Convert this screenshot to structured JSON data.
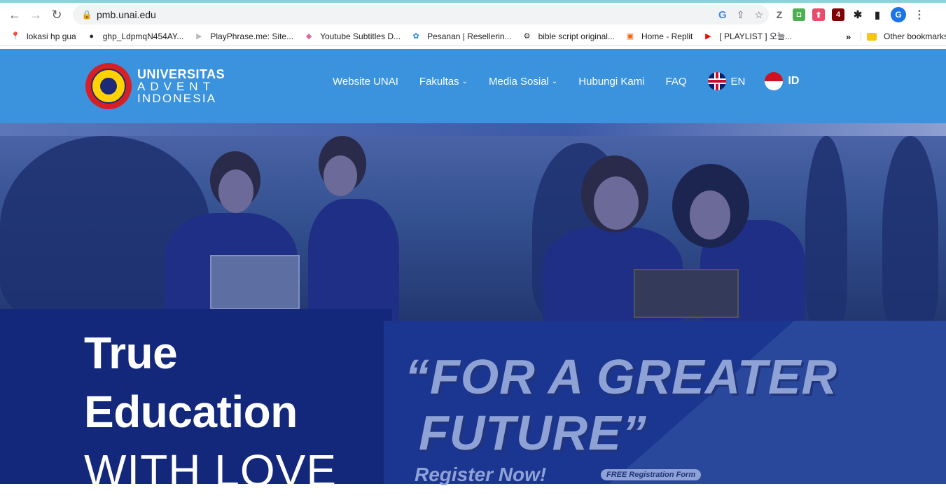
{
  "browser": {
    "url": "pmb.unai.edu",
    "back_icon": "←",
    "forward_icon": "→",
    "reload_icon": "↻",
    "lock_icon": "🔒",
    "google_icon": "G",
    "share_icon": "⇪",
    "star_icon": "☆",
    "menu_icon": "⋮",
    "avatar_letter": "G",
    "extensions": [
      {
        "name": "z-extension",
        "glyph": "Z",
        "color": "#5f6368"
      },
      {
        "name": "green-extension",
        "glyph": "◘",
        "color": "#4caf50"
      },
      {
        "name": "upload-extension",
        "glyph": "⬆",
        "color": "#e84c6b"
      },
      {
        "name": "ublock-extension",
        "glyph": "4",
        "color": "#800000"
      }
    ],
    "puzzle_icon": "✱",
    "sidepanel_icon": "▮"
  },
  "bookmarks": {
    "items": [
      {
        "label": "lokasi hp gua",
        "icon": "📍"
      },
      {
        "label": "ghp_LdpmqN454AY...",
        "icon": "●"
      },
      {
        "label": "PlayPhrase.me: Site...",
        "icon": "▶"
      },
      {
        "label": "Youtube Subtitles D...",
        "icon": "◆"
      },
      {
        "label": "Pesanan | Resellerin...",
        "icon": "✿"
      },
      {
        "label": "bible script original...",
        "icon": "⚙"
      },
      {
        "label": "Home - Replit",
        "icon": "▣"
      },
      {
        "label": "[ PLAYLIST ] 오늘...",
        "icon": "▶"
      }
    ],
    "more": "»",
    "other": "Other bookmarks"
  },
  "site": {
    "logo": {
      "line1": "UNIVERSITAS",
      "line2": "ADVENT",
      "line3": "INDONESIA"
    },
    "nav": [
      {
        "label": "Website UNAI",
        "dropdown": false
      },
      {
        "label": "Fakultas",
        "dropdown": true
      },
      {
        "label": "Media Sosial",
        "dropdown": true
      },
      {
        "label": "Hubungi Kami",
        "dropdown": false
      },
      {
        "label": "FAQ",
        "dropdown": false
      }
    ],
    "lang_en": "EN",
    "lang_id": "ID",
    "chevron": "⌄"
  },
  "hero": {
    "line1": "True",
    "line2": "Education",
    "line3": "WITH LOVE",
    "slogan1": "“FOR A GREATER",
    "slogan2": "FUTURE”",
    "register": "Register Now!",
    "free_form": "FREE Registration Form"
  },
  "colors": {
    "header": "#3b93de",
    "hero_dark": "#13287a",
    "accent_text": "#8fa2d6"
  }
}
